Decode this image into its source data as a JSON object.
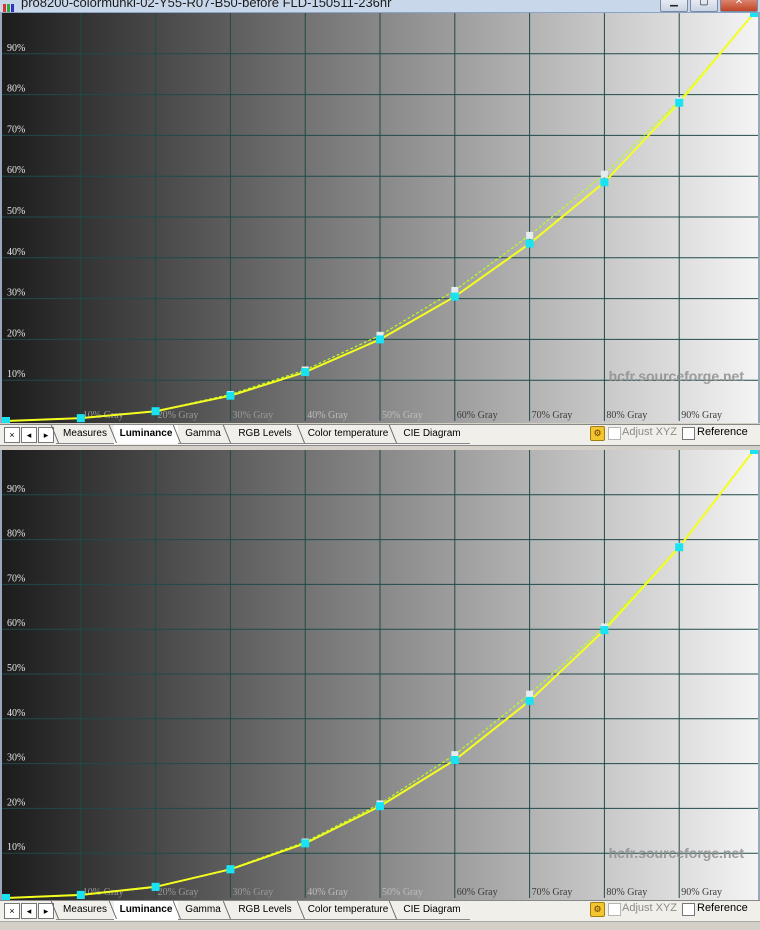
{
  "window": {
    "title": "pro8200-colormunki-02-Y55-R07-B50-before FLD-150511-236hr",
    "icon": "app-bars-icon",
    "buttons": [
      "minimize-icon",
      "maximize-icon",
      "close-icon"
    ]
  },
  "watermark": "hcfr.sourceforge.net",
  "tabs": [
    "Measures",
    "Luminance",
    "Gamma",
    "RGB Levels",
    "Color temperature",
    "CIE Diagram"
  ],
  "active_tab": "Luminance",
  "nav_buttons": [
    "×",
    "◂",
    "▸"
  ],
  "adjust_xyz_label": "Adjust XYZ",
  "reference_label": "Reference",
  "colors": {
    "measured_line": "#f4ff1f",
    "reference_line": "#b9ff1b",
    "measured_marker": "#19e3f3",
    "reference_marker": "#e4ecef",
    "grid": "#1f4a4a"
  },
  "chart_data": [
    {
      "type": "line",
      "x": [
        0,
        10,
        20,
        30,
        40,
        50,
        60,
        70,
        80,
        90,
        100
      ],
      "x_tick_labels": [
        "",
        "10% Gray",
        "20% Gray",
        "30% Gray",
        "40% Gray",
        "50% Gray",
        "60% Gray",
        "70% Gray",
        "80% Gray",
        "90% Gray"
      ],
      "y_tick_labels": [
        "10%",
        "20%",
        "30%",
        "40%",
        "50%",
        "60%",
        "70%",
        "80%",
        "90%"
      ],
      "xlim": [
        0,
        100
      ],
      "ylim": [
        0,
        100
      ],
      "grid": true,
      "series": [
        {
          "role": "measured",
          "values": [
            0,
            0.7,
            2.4,
            6.2,
            12.0,
            20.0,
            30.5,
            43.5,
            58.5,
            78.0,
            100
          ]
        },
        {
          "role": "reference",
          "values": [
            0,
            0.6,
            2.4,
            6.5,
            12.5,
            21.0,
            32.0,
            45.5,
            60.5,
            78.5,
            100
          ]
        }
      ]
    },
    {
      "type": "line",
      "x": [
        0,
        10,
        20,
        30,
        40,
        50,
        60,
        70,
        80,
        90,
        100
      ],
      "x_tick_labels": [
        "",
        "10% Gray",
        "20% Gray",
        "30% Gray",
        "40% Gray",
        "50% Gray",
        "60% Gray",
        "70% Gray",
        "80% Gray",
        "90% Gray"
      ],
      "y_tick_labels": [
        "10%",
        "20%",
        "30%",
        "40%",
        "50%",
        "60%",
        "70%",
        "80%",
        "90%"
      ],
      "xlim": [
        0,
        100
      ],
      "ylim": [
        0,
        100
      ],
      "grid": true,
      "series": [
        {
          "role": "measured",
          "values": [
            0,
            0.7,
            2.5,
            6.4,
            12.2,
            20.5,
            30.8,
            44.0,
            59.8,
            78.3,
            100
          ]
        },
        {
          "role": "reference",
          "values": [
            0,
            0.6,
            2.4,
            6.5,
            12.5,
            21.0,
            32.0,
            45.5,
            60.5,
            78.5,
            100
          ]
        }
      ]
    }
  ]
}
